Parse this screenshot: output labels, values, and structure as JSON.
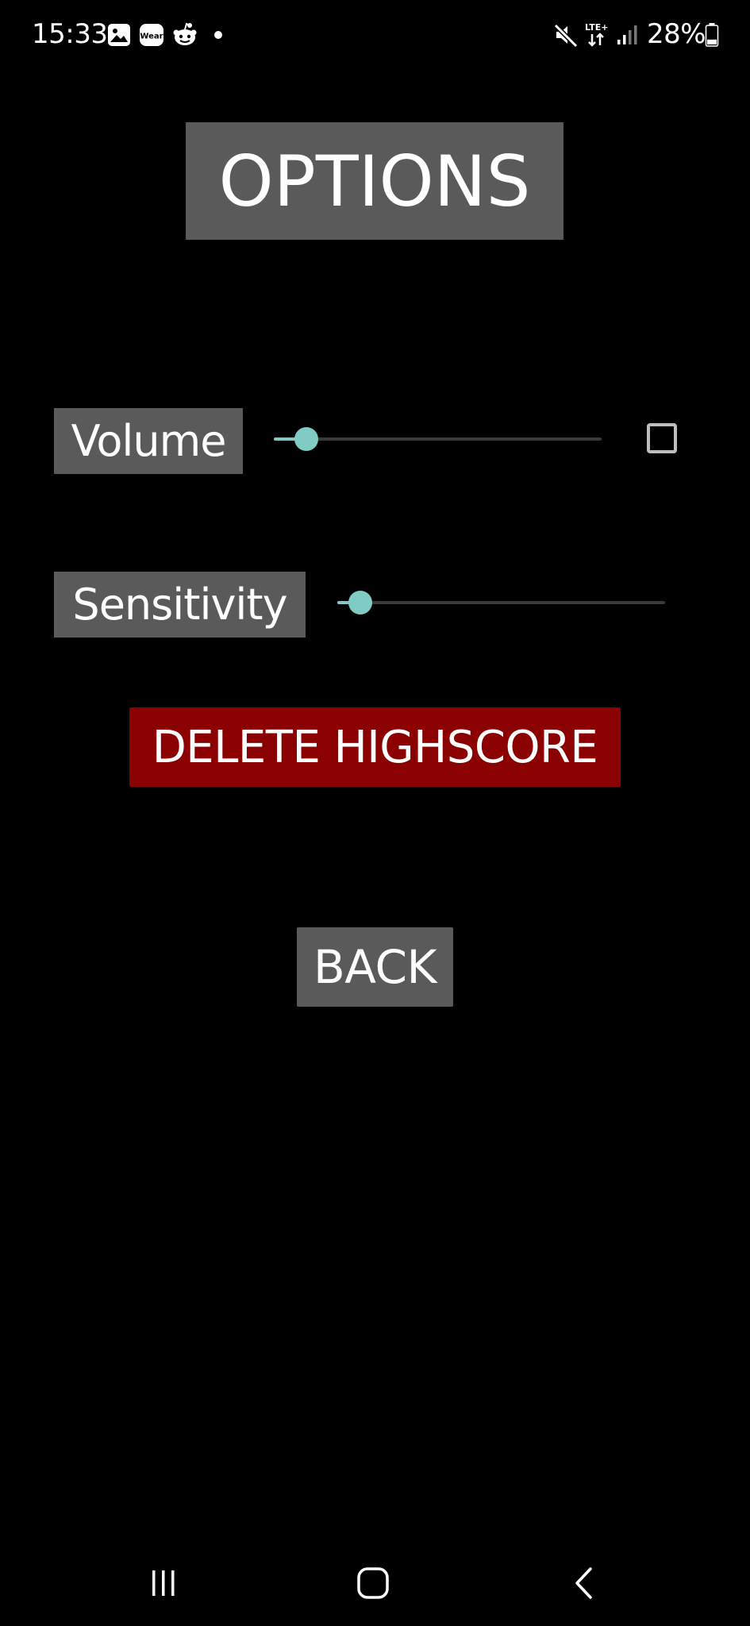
{
  "status_bar": {
    "time": "15:33",
    "notification_icons": [
      "gallery-icon",
      "wear-icon",
      "reddit-icon",
      "dot-icon"
    ],
    "wear_badge_text": "Wear",
    "system_icons": [
      "mute-icon",
      "lte-icon",
      "signal-icon",
      "battery-icon"
    ],
    "network_label": "LTE+",
    "battery_percent": "28%",
    "battery_level": 0.28
  },
  "options_screen": {
    "title": "OPTIONS",
    "volume": {
      "label": "Volume",
      "value": 0.1,
      "muted": false
    },
    "sensitivity": {
      "label": "Sensitivity",
      "value": 0.07
    },
    "delete_highscore_label": "DELETE HIGHSCORE",
    "back_label": "BACK"
  },
  "nav_bar": {
    "buttons": [
      "recents-icon",
      "home-icon",
      "back-icon"
    ]
  },
  "colors": {
    "background": "#000000",
    "panel": "#5a5a5a",
    "danger": "#8b0000",
    "slider_accent": "#80cbc4",
    "slider_track": "#3a3a3a",
    "text": "#ffffff"
  }
}
